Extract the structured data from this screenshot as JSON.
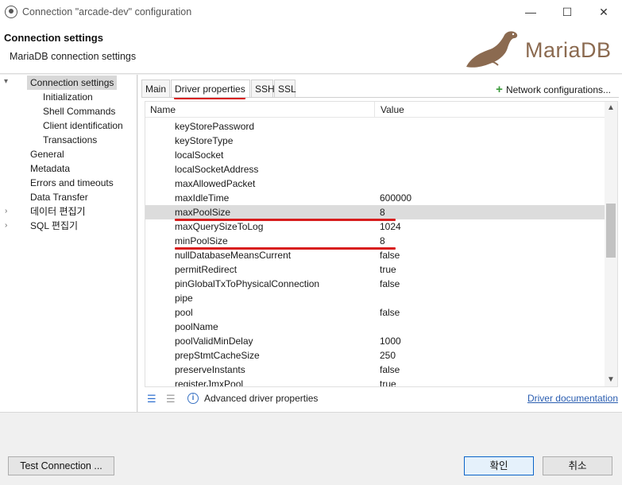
{
  "window": {
    "title": "Connection \"arcade-dev\" configuration",
    "minimize": "—",
    "maximize": "☐",
    "close": "✕"
  },
  "header": {
    "title": "Connection settings",
    "subtitle": "MariaDB connection settings",
    "logo_text": "MariaDB"
  },
  "nav": {
    "items": [
      {
        "label": "Connection settings"
      },
      {
        "label": "Initialization"
      },
      {
        "label": "Shell Commands"
      },
      {
        "label": "Client identification"
      },
      {
        "label": "Transactions"
      },
      {
        "label": "General"
      },
      {
        "label": "Metadata"
      },
      {
        "label": "Errors and timeouts"
      },
      {
        "label": "Data Transfer"
      },
      {
        "label": "데이터 편집기"
      },
      {
        "label": "SQL 편집기"
      }
    ],
    "selected": "Connection settings"
  },
  "tabs": {
    "items": [
      {
        "label": "Main"
      },
      {
        "label": "Driver properties"
      },
      {
        "label": "SSH"
      },
      {
        "label": "SSL"
      }
    ],
    "active": "Driver properties",
    "network_config": "Network configurations..."
  },
  "table": {
    "headers": {
      "name": "Name",
      "value": "Value"
    },
    "rows": [
      {
        "name": "keyStorePassword",
        "value": ""
      },
      {
        "name": "keyStoreType",
        "value": ""
      },
      {
        "name": "localSocket",
        "value": ""
      },
      {
        "name": "localSocketAddress",
        "value": ""
      },
      {
        "name": "maxAllowedPacket",
        "value": ""
      },
      {
        "name": "maxIdleTime",
        "value": "600000"
      },
      {
        "name": "maxPoolSize",
        "value": "8"
      },
      {
        "name": "maxQuerySizeToLog",
        "value": "1024"
      },
      {
        "name": "minPoolSize",
        "value": "8"
      },
      {
        "name": "nullDatabaseMeansCurrent",
        "value": "false"
      },
      {
        "name": "permitRedirect",
        "value": "true"
      },
      {
        "name": "pinGlobalTxToPhysicalConnection",
        "value": "false"
      },
      {
        "name": "pipe",
        "value": ""
      },
      {
        "name": "pool",
        "value": "false"
      },
      {
        "name": "poolName",
        "value": ""
      },
      {
        "name": "poolValidMinDelay",
        "value": "1000"
      },
      {
        "name": "prepStmtCacheSize",
        "value": "250"
      },
      {
        "name": "preserveInstants",
        "value": "false"
      },
      {
        "name": "registerJmxPool",
        "value": "true"
      }
    ],
    "highlighted_row": "maxPoolSize"
  },
  "bottom": {
    "advanced_label": "Advanced driver properties",
    "driver_doc": "Driver documentation"
  },
  "footer": {
    "test_connection": "Test Connection ...",
    "ok": "확인",
    "cancel": "취소"
  },
  "colors": {
    "annotation_red": "#d81e1e",
    "link_blue": "#2a5db0",
    "primary_border": "#0a64c8"
  }
}
